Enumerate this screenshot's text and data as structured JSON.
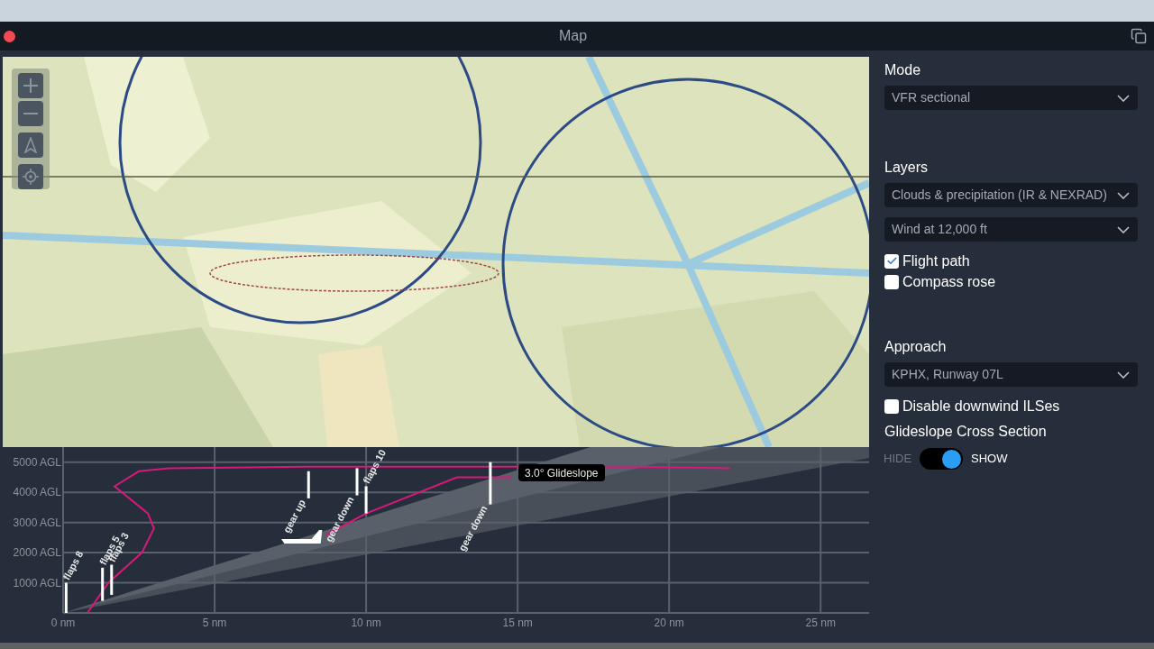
{
  "window": {
    "title": "Map"
  },
  "cross_section": {
    "tooltip": "3.0° Glideslope",
    "chart_data": {
      "type": "line",
      "grid": true,
      "x": [
        0.8,
        1.5,
        2.6,
        3.0,
        2.8,
        1.7,
        2.5,
        3.5,
        8.0,
        12,
        19,
        22,
        8.7,
        10,
        13,
        14.8
      ],
      "series": [
        {
          "color": "#d6197a",
          "values": [
            0,
            1000,
            2000,
            2800,
            3300,
            4200,
            4700,
            4800,
            4850,
            4850,
            4850,
            4800,
            null,
            null,
            null,
            null
          ]
        },
        {
          "color": "#d6197a",
          "values": [
            null,
            null,
            null,
            null,
            null,
            null,
            null,
            null,
            null,
            null,
            null,
            null,
            2600,
            3300,
            4500,
            4500
          ]
        }
      ],
      "xlim": [
        0,
        26.6
      ],
      "ylim": [
        0,
        5500
      ],
      "xticks": [
        {
          "value": 0,
          "label": "0 nm"
        },
        {
          "value": 5,
          "label": "5 nm"
        },
        {
          "value": 10,
          "label": "10 nm"
        },
        {
          "value": 15,
          "label": "15 nm"
        },
        {
          "value": 20,
          "label": "20 nm"
        },
        {
          "value": 25,
          "label": "25 nm"
        }
      ],
      "yticks": [
        {
          "value": 1000,
          "label": "1000 AGL"
        },
        {
          "value": 2000,
          "label": "2000 AGL"
        },
        {
          "value": 3000,
          "label": "3000 AGL"
        },
        {
          "value": 4000,
          "label": "4000 AGL"
        },
        {
          "value": 5000,
          "label": "5000 AGL"
        }
      ],
      "annotations": [
        "flaps 8",
        "flaps 5",
        "flaps 3",
        "gear up",
        "gear down",
        "flaps 10",
        "gear down"
      ]
    }
  },
  "panel": {
    "mode": {
      "label": "Mode",
      "value": "VFR sectional"
    },
    "layers": {
      "label": "Layers",
      "dropdowns": [
        "Clouds & precipitation (IR & NEXRAD)",
        "Wind at 12,000 ft"
      ],
      "checkboxes": [
        {
          "label": "Flight path",
          "checked": true
        },
        {
          "label": "Compass rose",
          "checked": false
        }
      ]
    },
    "approach": {
      "label": "Approach",
      "value": "KPHX, Runway 07L",
      "checkbox": {
        "label": "Disable downwind ILSes",
        "checked": false
      }
    },
    "glideslope": {
      "label": "Glideslope Cross Section",
      "off_label": "HIDE",
      "on_label": "SHOW",
      "on": true
    }
  }
}
